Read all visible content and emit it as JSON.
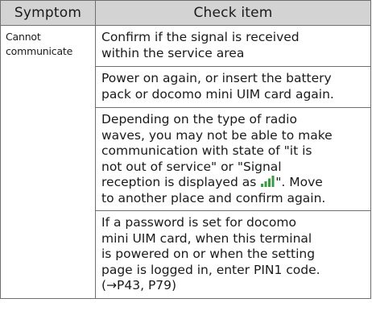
{
  "table": {
    "headers": [
      "Symptom",
      "Check item"
    ],
    "symptom": "Cannot\ncommunicate",
    "check_items": [
      "Confirm if the signal is received\nwithin the service area",
      "Power on again, or insert the battery\npack or docomo mini UIM card again.",
      {
        "before_icon": "Depending on the type of radio\nwaves, you may not be able to make\ncommunication with state of \"it is\nnot out of service\" or \"Signal\nreception is displayed as ",
        "icon": "signal-bars-icon",
        "after_icon": "\". Move\nto another place and confirm again."
      },
      "If a password is set for docomo\nmini UIM card, when this terminal\nis powered on or when the setting\npage is logged in, enter PIN1 code.\n(→P43, P79)"
    ]
  }
}
